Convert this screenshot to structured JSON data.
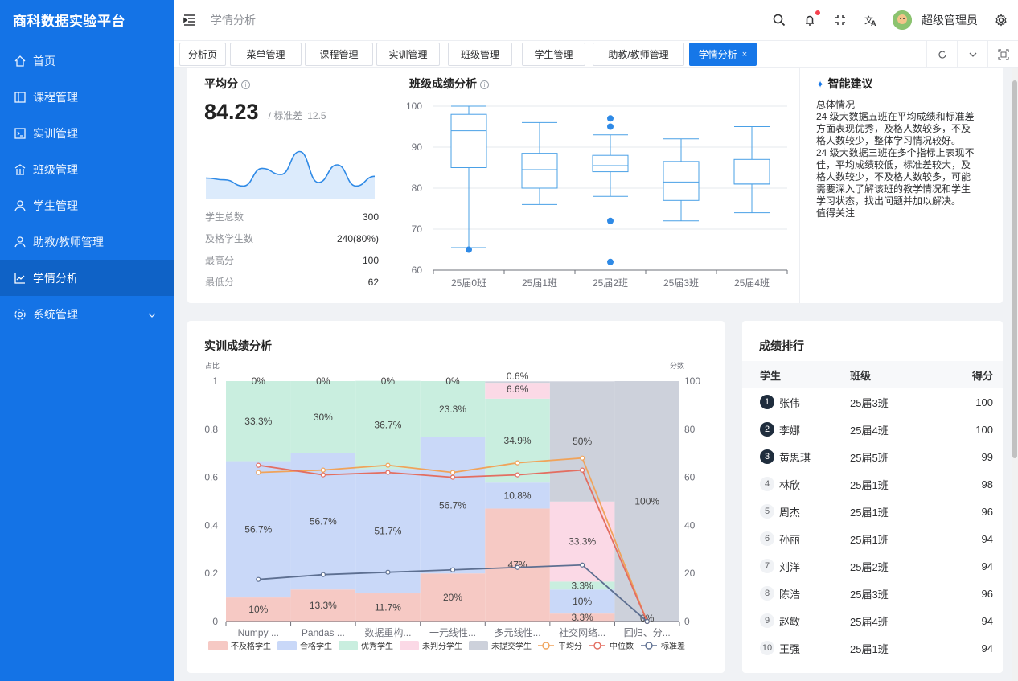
{
  "app": {
    "title": "商科数据实验平台"
  },
  "sidebar": {
    "items": [
      {
        "label": "首页",
        "icon": "home-icon"
      },
      {
        "label": "课程管理",
        "icon": "book-icon"
      },
      {
        "label": "实训管理",
        "icon": "terminal-icon"
      },
      {
        "label": "班级管理",
        "icon": "bank-icon"
      },
      {
        "label": "学生管理",
        "icon": "user-icon"
      },
      {
        "label": "助教/教师管理",
        "icon": "user-icon"
      },
      {
        "label": "学情分析",
        "icon": "chart-icon",
        "active": true
      },
      {
        "label": "系统管理",
        "icon": "gear-icon"
      }
    ]
  },
  "header": {
    "breadcrumb": "学情分析",
    "username": "超级管理员"
  },
  "tabs": [
    "分析页",
    "菜单管理",
    "课程管理",
    "实训管理",
    "班级管理",
    "学生管理",
    "助教/教师管理",
    "学情分析"
  ],
  "avg": {
    "title": "平均分",
    "value": "84.23",
    "std_label": "/ 标准差",
    "std": "12.5",
    "trend": [
      0.3,
      0.26,
      0.12,
      0.52,
      0.38,
      0.9,
      0.2,
      0.6,
      0.12,
      0.34
    ],
    "stats": [
      {
        "k": "学生总数",
        "v": "300"
      },
      {
        "k": "及格学生数",
        "v": "240(80%)"
      },
      {
        "k": "最高分",
        "v": "100"
      },
      {
        "k": "最低分",
        "v": "62"
      }
    ]
  },
  "classScore": {
    "title": "班级成绩分析",
    "yticks": [
      100,
      90,
      80,
      70,
      60
    ]
  },
  "advice": {
    "title": "智能建议",
    "lines": [
      "总体情况",
      "24 级大数据五班在平均成绩和标准差",
      "方面表现优秀，及格人数较多，不及",
      "格人数较少，整体学习情况较好。",
      "24 级大数据三班在多个指标上表现不",
      "佳，平均成绩较低，标准差较大，及",
      "格人数较少，不及格人数较多，可能",
      "需要深入了解该班的教学情况和学生",
      "学习状态，找出问题并加以解决。",
      "值得关注"
    ]
  },
  "training": {
    "title": "实训成绩分析"
  },
  "ranking": {
    "title": "成绩排行",
    "headers": [
      "学生",
      "班级",
      "得分"
    ],
    "rows": [
      {
        "rank": "1",
        "name": "张伟",
        "cls": "25届3班",
        "score": "100"
      },
      {
        "rank": "2",
        "name": "李娜",
        "cls": "25届4班",
        "score": "100"
      },
      {
        "rank": "3",
        "name": "黄思琪",
        "cls": "25届5班",
        "score": "99"
      },
      {
        "rank": "4",
        "name": "林欣",
        "cls": "25届1班",
        "score": "98"
      },
      {
        "rank": "5",
        "name": "周杰",
        "cls": "25届1班",
        "score": "96"
      },
      {
        "rank": "6",
        "name": "孙丽",
        "cls": "25届1班",
        "score": "94"
      },
      {
        "rank": "7",
        "name": "刘洋",
        "cls": "25届2班",
        "score": "94"
      },
      {
        "rank": "8",
        "name": "陈浩",
        "cls": "25届3班",
        "score": "96"
      },
      {
        "rank": "9",
        "name": "赵敏",
        "cls": "25届4班",
        "score": "94"
      },
      {
        "rank": "10",
        "name": "王强",
        "cls": "25届1班",
        "score": "94"
      }
    ]
  },
  "chart_data": [
    {
      "type": "box",
      "title": "班级成绩分析",
      "ylim": [
        60,
        100
      ],
      "categories": [
        "25届0班",
        "25届1班",
        "25届2班",
        "25届3班",
        "25届4班"
      ],
      "boxes": [
        {
          "min": 65.5,
          "q1": 85,
          "median": 94,
          "q3": 98,
          "max": 100,
          "outliers": [
            65
          ]
        },
        {
          "min": 76,
          "q1": 80,
          "median": 84.5,
          "q3": 88.5,
          "max": 96,
          "outliers": []
        },
        {
          "min": 78,
          "q1": 84,
          "median": 85.5,
          "q3": 88,
          "max": 93,
          "outliers": [
            97,
            95,
            72,
            62
          ]
        },
        {
          "min": 72,
          "q1": 77,
          "median": 81.5,
          "q3": 86.5,
          "max": 92,
          "outliers": []
        },
        {
          "min": 74,
          "q1": 81,
          "median": 81,
          "q3": 87,
          "max": 95,
          "outliers": []
        }
      ]
    },
    {
      "type": "bar",
      "title": "实训成绩分析",
      "ylabel": "占比",
      "y2label": "分数",
      "ylim": [
        0,
        1
      ],
      "y2lim": [
        0,
        100
      ],
      "categories": [
        "Numpy ...",
        "Pandas ...",
        "数据重构...",
        "一元线性...",
        "多元线性...",
        "社交网络...",
        "回归、分..."
      ],
      "series": [
        {
          "name": "不及格学生",
          "color": "#f6c9c4",
          "values": [
            10,
            13.3,
            11.7,
            20,
            47,
            3.3,
            0
          ],
          "labels": [
            "10%",
            "13.3%",
            "11.7%",
            "20%",
            "47%",
            "3.3%",
            "0%"
          ]
        },
        {
          "name": "合格学生",
          "color": "#c9d8f8",
          "values": [
            56.7,
            56.7,
            51.7,
            56.7,
            10.8,
            10,
            0
          ],
          "labels": [
            "56.7%",
            "56.7%",
            "51.7%",
            "56.7%",
            "10.8%",
            "10%",
            ""
          ]
        },
        {
          "name": "优秀学生",
          "color": "#c9eedf",
          "values": [
            33.3,
            30,
            36.7,
            23.3,
            34.9,
            3.3,
            0
          ],
          "labels": [
            "33.3%",
            "30%",
            "36.7%",
            "23.3%",
            "34.9%",
            "3.3%",
            ""
          ]
        },
        {
          "name": "未判分学生",
          "color": "#fbd9e6",
          "values": [
            0,
            0,
            0,
            0,
            6.6,
            33.3,
            0
          ],
          "labels": [
            "0%",
            "0%",
            "0%",
            "0%",
            "6.6%",
            "33.3%",
            ""
          ]
        },
        {
          "name": "未提交学生",
          "color": "#cdd1db",
          "values": [
            0,
            0,
            0,
            0,
            0.6,
            50,
            100
          ],
          "labels": [
            "",
            "",
            "",
            "",
            "0.6%",
            "50%",
            "100%"
          ]
        }
      ],
      "lines": [
        {
          "name": "平均分",
          "color": "#f0a35a",
          "values": [
            62,
            63,
            65,
            62,
            66,
            68,
            0
          ]
        },
        {
          "name": "中位数",
          "color": "#e36e61",
          "values": [
            65,
            61,
            62,
            60,
            61,
            63,
            0
          ]
        },
        {
          "name": "标准差",
          "color": "#5d6f91",
          "values": [
            17.5,
            19.5,
            20.5,
            21.5,
            22.5,
            23.5,
            0
          ]
        }
      ]
    }
  ]
}
